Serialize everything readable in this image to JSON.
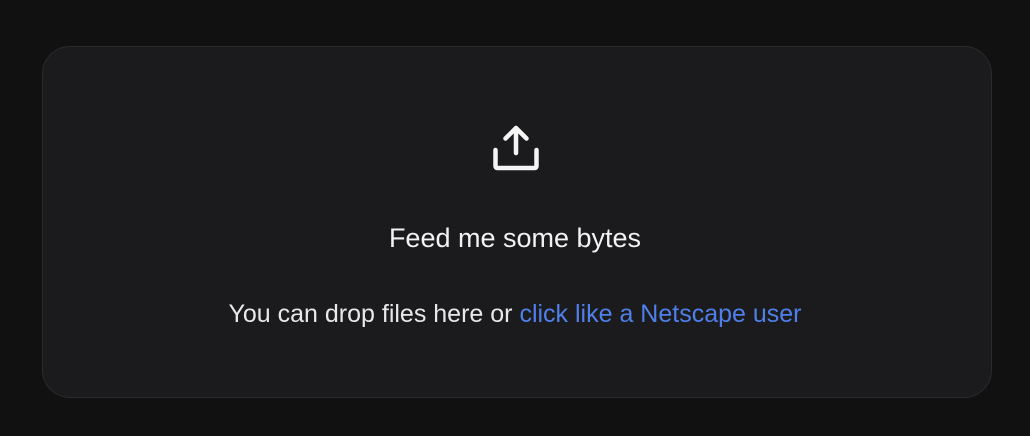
{
  "dropzone": {
    "icon": "upload-icon",
    "title": "Feed me some bytes",
    "hint_prefix": "You can drop files here or",
    "hint_link": "click like a Netscape user"
  },
  "colors": {
    "background": "#111112",
    "panel": "#1b1b1d",
    "panel_border": "#2a2a2d",
    "text": "#f2f2f3",
    "link": "#4f7fe8"
  }
}
